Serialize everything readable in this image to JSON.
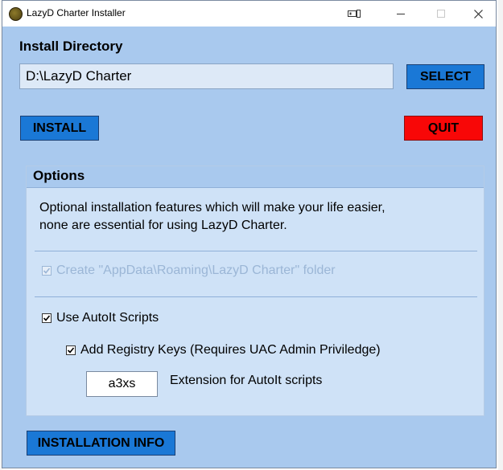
{
  "window": {
    "title": "LazyD Charter Installer"
  },
  "install": {
    "directory_label": "Install Directory",
    "directory_value": "D:\\LazyD Charter",
    "select_label": "SELECT",
    "install_label": "INSTALL",
    "quit_label": "QUIT"
  },
  "options": {
    "title": "Options",
    "description_line1": "Optional installation features which will make your life easier,",
    "description_line2": "none are essential for using LazyD Charter.",
    "appdata_label": "Create \"AppData\\Roaming\\LazyD Charter\" folder",
    "appdata_checked": true,
    "appdata_enabled": false,
    "autoit_label": "Use AutoIt Scripts",
    "autoit_checked": true,
    "registry_label": "Add Registry Keys (Requires UAC Admin Priviledge)",
    "registry_checked": true,
    "extension_value": "a3xs",
    "extension_label": "Extension for AutoIt scripts"
  },
  "footer": {
    "info_label": "INSTALLATION INFO"
  },
  "colors": {
    "window_bg": "#a9c9ee",
    "group_bg": "#cfe2f7",
    "button_blue": "#1a78d6",
    "button_red": "#f80707"
  },
  "icons": {
    "app": "app-icon",
    "minimize": "minimize-icon",
    "maximize": "maximize-icon",
    "close": "close-icon",
    "media": "tablet-mode-icon"
  }
}
